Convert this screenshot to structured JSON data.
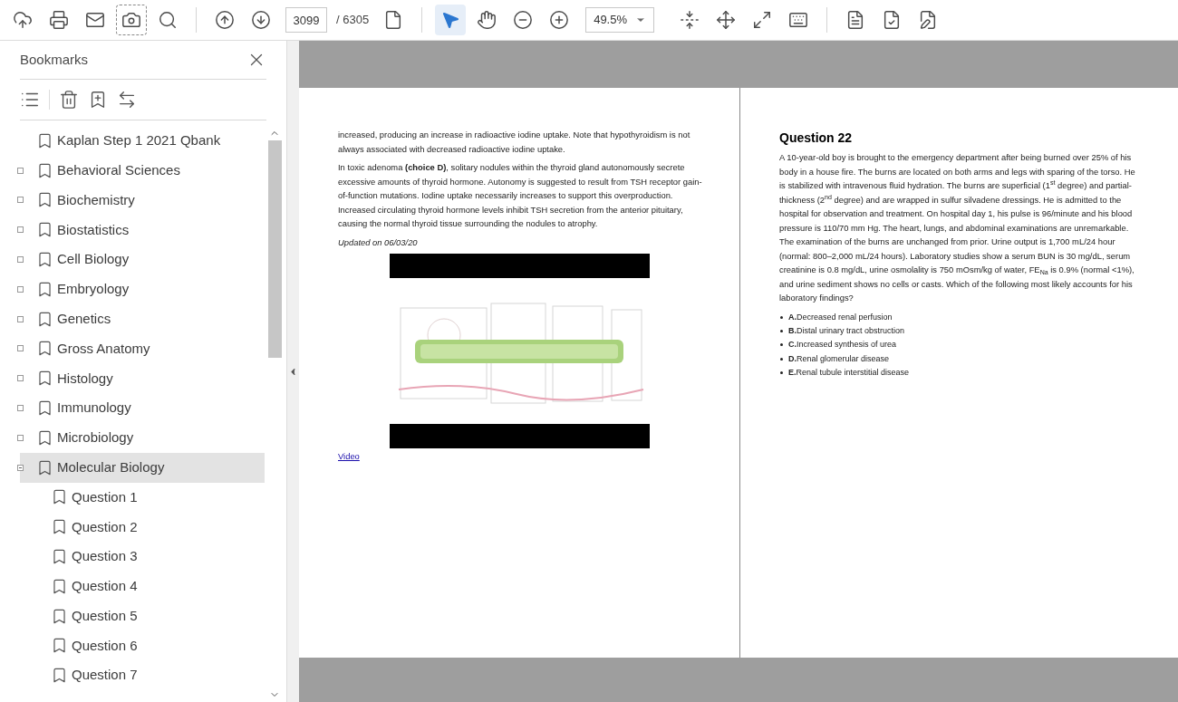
{
  "toolbar": {
    "page_number": "3099",
    "page_total": "/ 6305",
    "zoom": "49.5%",
    "tools": [
      {
        "kind": "select",
        "selected": true
      },
      {
        "kind": "hand",
        "selected": false
      }
    ]
  },
  "sidebar": {
    "title": "Bookmarks",
    "tree": [
      {
        "label": "Kaplan Step 1 2021 Qbank",
        "selected": false,
        "children": [
          {
            "label": "Behavioral Sciences",
            "selected": false,
            "expanded": false
          },
          {
            "label": "Biochemistry",
            "selected": false,
            "expanded": false
          },
          {
            "label": "Biostatistics",
            "selected": false,
            "expanded": false
          },
          {
            "label": "Cell Biology",
            "selected": false,
            "expanded": false
          },
          {
            "label": "Embryology",
            "selected": false,
            "expanded": false
          },
          {
            "label": "Genetics",
            "selected": false,
            "expanded": false
          },
          {
            "label": "Gross Anatomy",
            "selected": false,
            "expanded": false
          },
          {
            "label": "Histology",
            "selected": false,
            "expanded": false
          },
          {
            "label": "Immunology",
            "selected": false,
            "expanded": false
          },
          {
            "label": "Microbiology",
            "selected": false,
            "expanded": false
          },
          {
            "label": "Molecular Biology",
            "selected": true,
            "expanded": true,
            "children": [
              {
                "label": "Question 1",
                "selected": false
              },
              {
                "label": "Question 2",
                "selected": false
              },
              {
                "label": "Question 3",
                "selected": false
              },
              {
                "label": "Question 4",
                "selected": false
              },
              {
                "label": "Question 5",
                "selected": false
              },
              {
                "label": "Question 6",
                "selected": false
              },
              {
                "label": "Question 7",
                "selected": false
              }
            ]
          }
        ]
      }
    ]
  },
  "left_page": {
    "paragraphs": [
      "increased, producing an increase in radioactive iodine uptake. Note that hypothyroidism is not always associated with decreased radioactive iodine uptake.",
      "In toxic adenoma **(choice D)**, solitary nodules within the thyroid gland autonomously secrete excessive amounts of thyroid hormone. Autonomy is suggested to result from TSH receptor gain-of-function mutations.  Iodine uptake necessarily increases to support this overproduction. Increased circulating thyroid hormone levels inhibit TSH secretion from the anterior pituitary, causing the normal thyroid tissue surrounding the nodules to atrophy."
    ],
    "updated": "Updated on 06/03/20",
    "video_link": "Video"
  },
  "right_page": {
    "heading": "Question 22",
    "question": "A 10-year-old boy is brought to the emergency department after being burned over 25% of his body in a house fire. The burns are located on both arms and legs with sparing of the torso. He is stabilized with intravenous fluid hydration. The burns are superficial (1$^{st}$ degree) and partial-thickness (2$^{nd}$ degree) and are wrapped in sulfur silvadene dressings. He is admitted to the hospital for observation and treatment. On hospital day 1, his pulse is 96/minute and his blood pressure is 110/70 mm Hg. The heart, lungs, and abdominal examinations are unremarkable. The examination of the burns are unchanged from prior. Urine output is 1,700 mL/24 hour (normal: 800–2,000 mL/24 hours). Laboratory studies show a serum BUN is 30 mg/dL, serum creatinine is 0.8 mg/dL, urine osmolality is 750 mOsm/kg of water, FE$_{Na}$ is 0.9% (normal <1%), and urine sediment shows no cells or casts. Which of the following most likely accounts for his laboratory findings?",
    "choices": [
      {
        "letter": "A.",
        "text": "Decreased renal perfusion"
      },
      {
        "letter": "B.",
        "text": "Distal urinary tract obstruction"
      },
      {
        "letter": "C.",
        "text": "Increased synthesis of urea"
      },
      {
        "letter": "D.",
        "text": "Renal glomerular disease"
      },
      {
        "letter": "E.",
        "text": "Renal tubule interstitial disease"
      }
    ]
  }
}
